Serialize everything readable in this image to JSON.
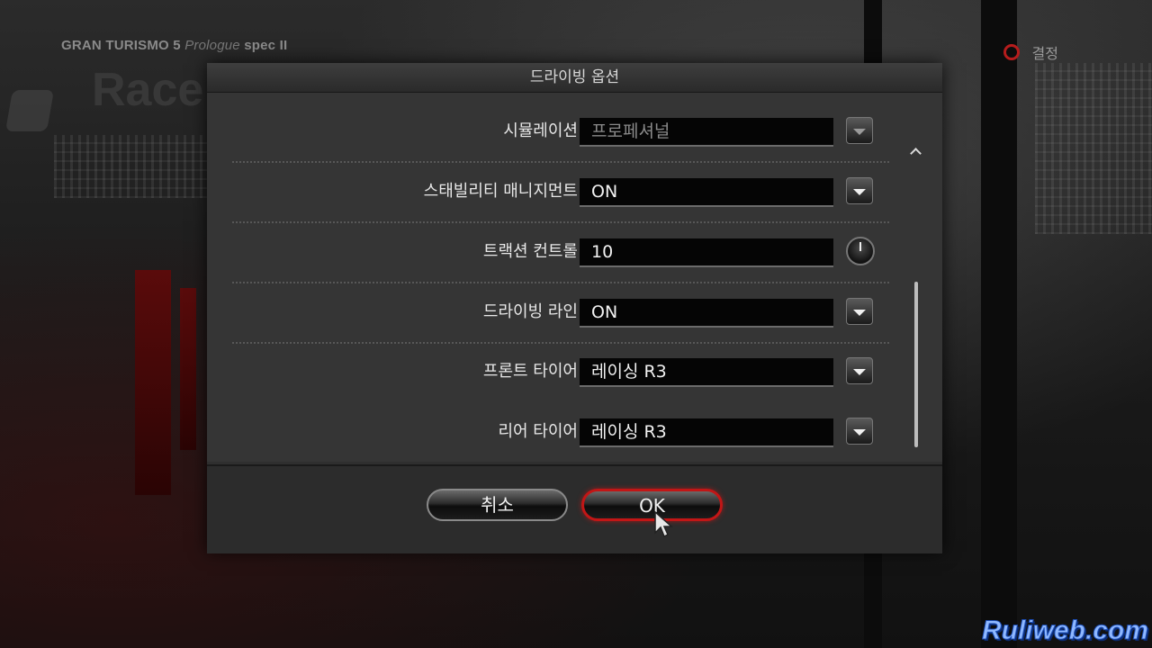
{
  "game": {
    "title_main": "GRAN TURISMO 5",
    "title_sub": "Prologue",
    "title_spec": "spec II",
    "background_text": "Race"
  },
  "hint": {
    "icon": "circle-button-icon",
    "label": "결정",
    "color": "#b51c1c"
  },
  "dialog": {
    "title": "드라이빙 옵션",
    "rows": [
      {
        "label": "시뮬레이션",
        "value": "프로페셔널",
        "control": "dropdown",
        "enabled": false
      },
      {
        "label": "스태빌리티 매니지먼트",
        "value": "ON",
        "control": "dropdown",
        "enabled": true
      },
      {
        "label": "트랙션 컨트롤",
        "value": "10",
        "control": "dial",
        "enabled": true
      },
      {
        "label": "드라이빙 라인",
        "value": "ON",
        "control": "dropdown",
        "enabled": true
      },
      {
        "label": "프론트 타이어",
        "value": "레이싱 R3",
        "control": "dropdown",
        "enabled": true
      },
      {
        "label": "리어 타이어",
        "value": "레이싱 R3",
        "control": "dropdown",
        "enabled": true
      }
    ],
    "cancel_label": "취소",
    "ok_label": "OK",
    "focus_color": "#c21616"
  },
  "watermark": "Ruliweb.com"
}
